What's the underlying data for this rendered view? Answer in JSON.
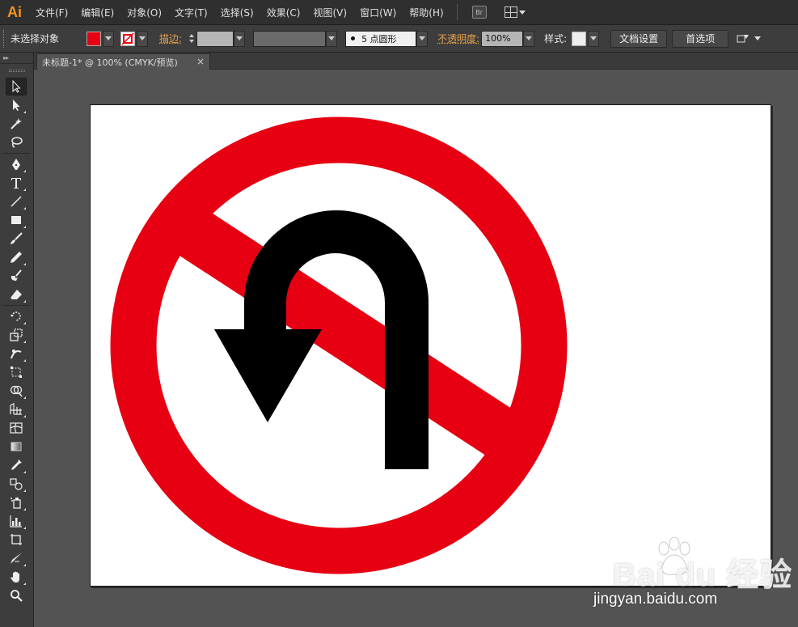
{
  "app": {
    "logo": "Ai"
  },
  "menu": [
    "文件(F)",
    "编辑(E)",
    "对象(O)",
    "文字(T)",
    "选择(S)",
    "效果(C)",
    "视图(V)",
    "窗口(W)",
    "帮助(H)"
  ],
  "menu_extra": {
    "bridge": "Br"
  },
  "control_bar": {
    "selection_status": "未选择对象",
    "fill_color": "#e60012",
    "stroke_label": "描边:",
    "brush_value": "5 点圆形",
    "opacity_label": "不透明度:",
    "opacity_value": "100%",
    "style_label": "样式:",
    "doc_setup": "文档设置",
    "preferences": "首选项"
  },
  "document_tab": {
    "title": "未标题-1* @ 100% (CMYK/预览)",
    "close": "×"
  },
  "sign": {
    "ring_color": "#e60012",
    "arrow_color": "#000000",
    "background": "#ffffff"
  },
  "watermark": {
    "brand": "Bai  du 经验",
    "url": "jingyan.baidu.com"
  }
}
